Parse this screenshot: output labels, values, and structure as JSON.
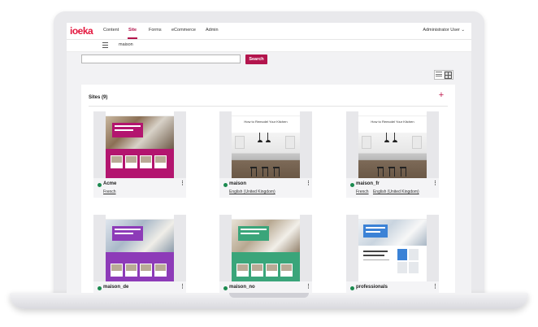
{
  "app": {
    "logo": "ioeka",
    "nav": [
      "Content",
      "Site",
      "Forms",
      "eCommerce",
      "Admin"
    ],
    "active_nav": "Site",
    "user_menu": "Administrator User ⌄"
  },
  "breadcrumb": "maison",
  "search": {
    "placeholder": "",
    "value": "",
    "button_label": "Search"
  },
  "sites_panel": {
    "title": "Sites (9)",
    "add_label": "+"
  },
  "sites": [
    {
      "name": "Acme",
      "languages": [
        "French"
      ],
      "status_color": "#1b8a4f",
      "theme": "magenta",
      "accent": "#b3156f"
    },
    {
      "name": "maison",
      "languages": [
        "English (United Kingdom)"
      ],
      "status_color": "#1b8a4f",
      "theme": "kitchen",
      "title_text": "How to Remodel Your Kitchen"
    },
    {
      "name": "maison_fr",
      "languages": [
        "French",
        "English (United Kingdom)"
      ],
      "status_color": "#1b8a4f",
      "theme": "kitchen",
      "title_text": "How to Remodel Your Kitchen"
    },
    {
      "name": "maison_de",
      "languages": [],
      "status_color": "#1b8a4f",
      "theme": "purple",
      "accent": "#8d3bb8"
    },
    {
      "name": "maison_no",
      "languages": [],
      "status_color": "#1b8a4f",
      "theme": "green",
      "accent": "#3aa57a"
    },
    {
      "name": "professionals",
      "languages": [],
      "status_color": "#1b8a4f",
      "theme": "blue",
      "accent": "#3b82d6"
    }
  ],
  "colors": {
    "brand": "#e3173e",
    "primary": "#b3154d",
    "status_live": "#1b8a4f"
  }
}
